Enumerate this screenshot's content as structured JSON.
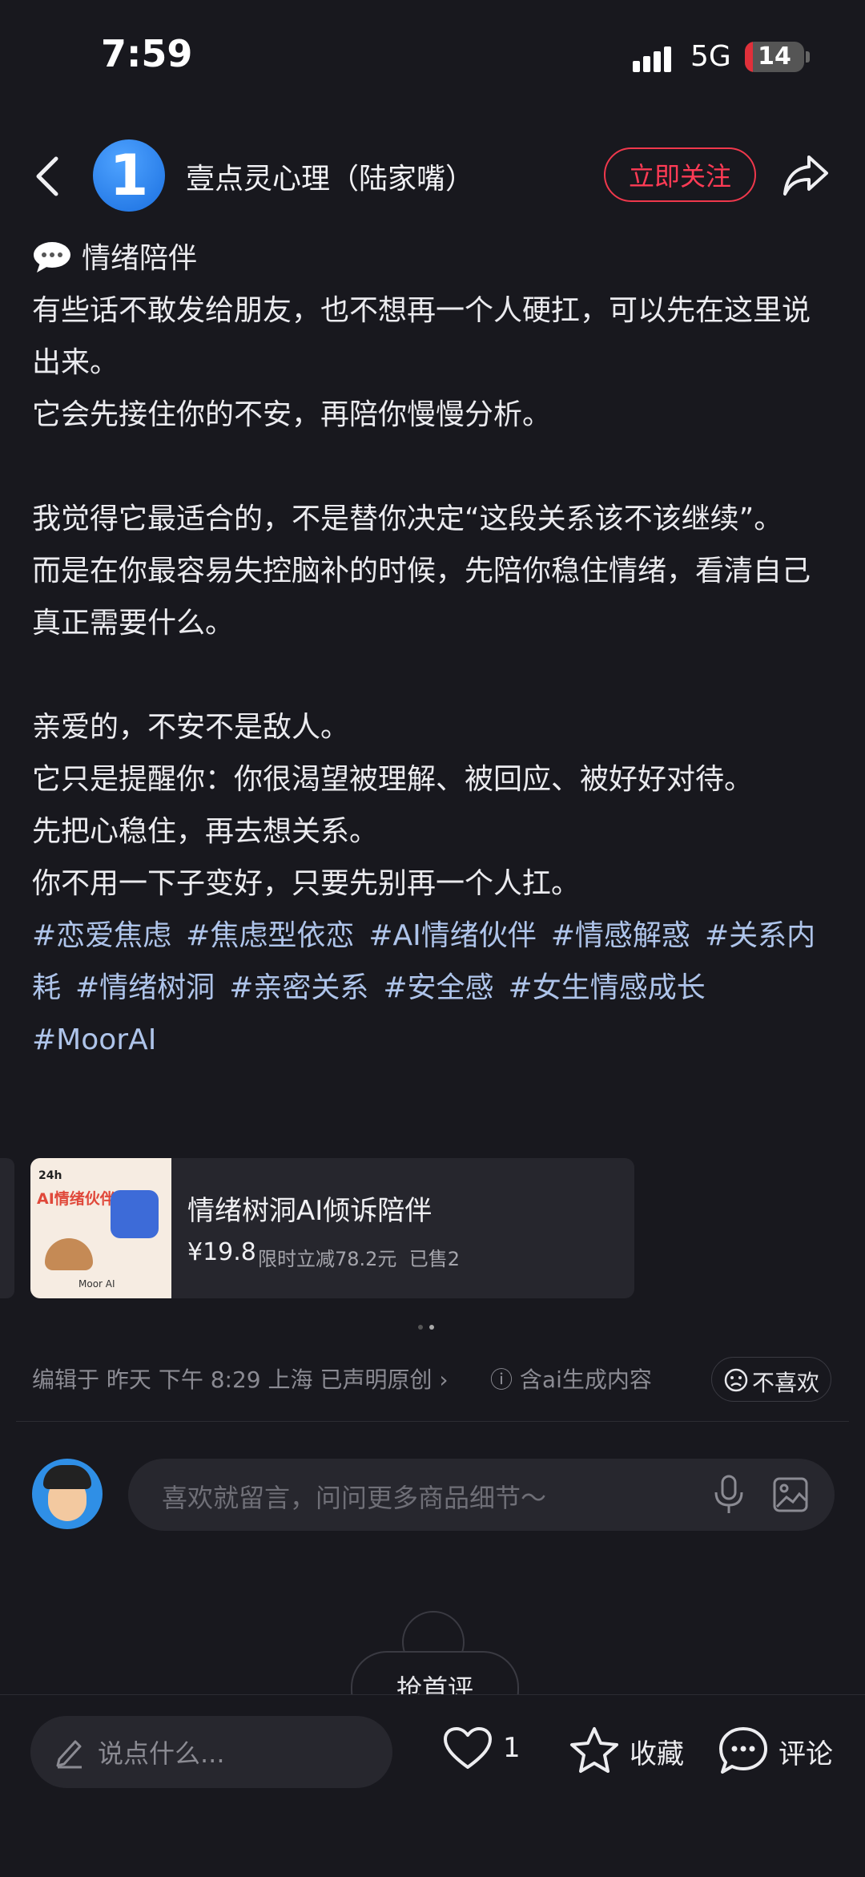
{
  "status_bar": {
    "time": "7:59",
    "network": "5G",
    "battery": "14",
    "battery_level": 0.14
  },
  "header": {
    "account_name": "壹点灵心理（陆家嘴）",
    "follow_label": "立即关注"
  },
  "post": {
    "section_title": "情绪陪伴",
    "paragraphs": [
      "有些话不敢发给朋友，也不想再一个人硬扛，可以先在这里说出来。",
      "它会先接住你的不安，再陪你慢慢分析。",
      "",
      "我觉得它最适合的，不是替你决定“这段关系该不该继续”。",
      "而是在你最容易失控脑补的时候，先陪你稳住情绪，看清自己真正需要什么。",
      "",
      "亲爱的，不安不是敌人。",
      "它只是提醒你：你很渴望被理解、被回应、被好好对待。",
      "先把心稳住，再去想关系。",
      "你不用一下子变好，只要先别再一个人扛。"
    ],
    "tags": [
      "#恋爱焦虑",
      "#焦虑型依恋",
      "#AI情绪伙伴",
      "#情感解惑",
      "#关系内耗",
      "#情绪树洞",
      "#亲密关系",
      "#安全感",
      "#女生情感成长",
      "#MoorAI"
    ]
  },
  "product": {
    "thumb_badge": "24h",
    "thumb_title": "AI情绪伙伴",
    "thumb_brand": "Moor AI",
    "title": "情绪树洞AI倾诉陪伴",
    "price": "¥19.8",
    "promo": "限时立减78.2元",
    "sold": "已售2"
  },
  "meta": {
    "edited": "编辑于",
    "date": "昨天 下午 8:29",
    "location": "上海",
    "original": "已声明原创",
    "aigc": "含ai生成内容",
    "dislike_label": "不喜欢"
  },
  "comment_input": {
    "placeholder": "喜欢就留言，问问更多商品细节～"
  },
  "empty_state": {
    "label": "抢首评"
  },
  "bottom_bar": {
    "say_placeholder": "说点什么...",
    "like_count": "1",
    "collect_label": "收藏",
    "comment_label": "评论"
  },
  "colors": {
    "accent": "#ff3b55",
    "tag": "#aec4ea",
    "background": "#18181e"
  }
}
